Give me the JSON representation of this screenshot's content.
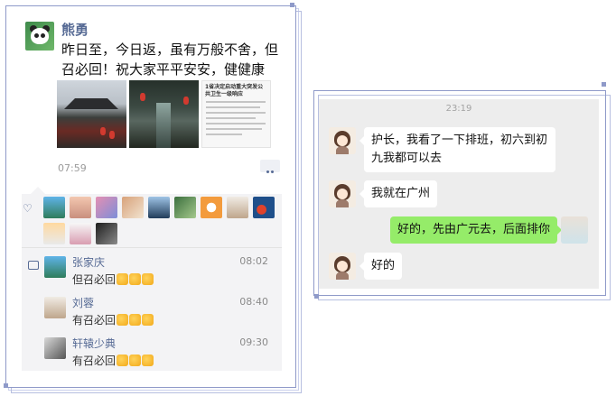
{
  "moment": {
    "author": "熊勇",
    "text": "昨日至，今日返，虽有万般不舍，但召必回！祝大家平平安安，健健康康！",
    "doc_preview_title": "1省决定启动重大突发公共卫生一级响应",
    "time": "07:59",
    "like_icon": "heart-icon",
    "comments": [
      {
        "name": "张家庆",
        "time": "08:02",
        "text": "但召必回"
      },
      {
        "name": "刘蓉",
        "time": "08:40",
        "text": "有召必回"
      },
      {
        "name": "轩辕少典",
        "time": "09:30",
        "text": "有召必回"
      }
    ]
  },
  "chat": {
    "time": "23:19",
    "messages": [
      {
        "side": "left",
        "text": "护长，我看了一下排班，初六到初九我都可以去"
      },
      {
        "side": "left",
        "text": "我就在广州"
      },
      {
        "side": "right",
        "text": "好的，先由广元去，后面排你"
      },
      {
        "side": "left",
        "text": "好的"
      }
    ]
  },
  "colors": {
    "name_blue": "#576b95",
    "frame_blue": "#8f9ac9",
    "my_bubble_green": "#95ec69",
    "chat_bg": "#ededed"
  }
}
